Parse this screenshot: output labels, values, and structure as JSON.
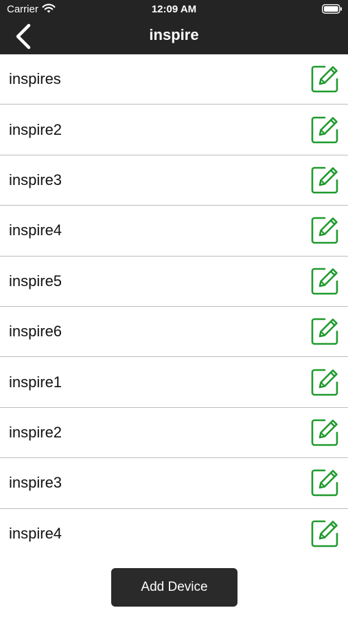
{
  "status_bar": {
    "carrier": "Carrier",
    "time": "12:09 AM",
    "icons": [
      "wifi-icon",
      "battery-icon"
    ]
  },
  "nav": {
    "title": "inspire",
    "back_icon": "chevron-left-icon"
  },
  "devices": [
    {
      "label": "inspires"
    },
    {
      "label": "inspire2"
    },
    {
      "label": "inspire3"
    },
    {
      "label": "inspire4"
    },
    {
      "label": "inspire5"
    },
    {
      "label": "inspire6"
    },
    {
      "label": "inspire1"
    },
    {
      "label": "inspire2"
    },
    {
      "label": "inspire3"
    },
    {
      "label": "inspire4"
    }
  ],
  "edit_icon": "edit-icon",
  "add_button_label": "Add Device",
  "colors": {
    "header_bg": "#242424",
    "accent_green": "#1e9a2c",
    "button_bg": "#2a2a2a"
  }
}
